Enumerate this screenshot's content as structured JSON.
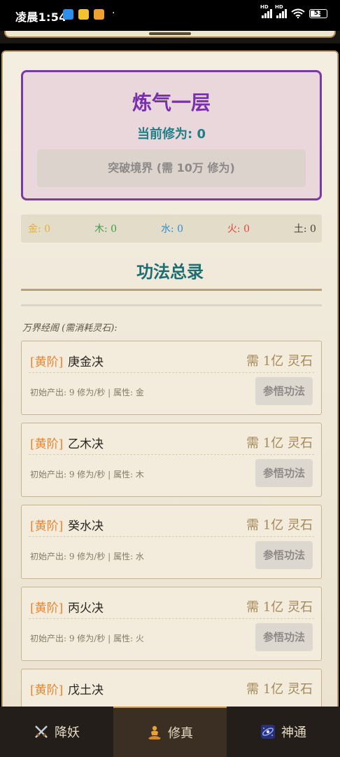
{
  "status_bar": {
    "time": "凌晨1:54",
    "battery": "53"
  },
  "realm": {
    "title": "炼气一层",
    "cultivation_label": "当前修为:",
    "cultivation_value": "0",
    "breakthrough_button": "突破境界 (需 10万 修为)"
  },
  "elements": [
    {
      "label": "金: 0",
      "color": "#e3b13a"
    },
    {
      "label": "木: 0",
      "color": "#3f9a4c"
    },
    {
      "label": "水: 0",
      "color": "#2f8fd1"
    },
    {
      "label": "火: 0",
      "color": "#e0473f"
    },
    {
      "label": "土: 0",
      "color": "#4a4036"
    }
  ],
  "section": {
    "title": "功法总录",
    "sub_label": "万界经阁 (需消耗灵石):"
  },
  "skills": [
    {
      "grade": "[黄阶]",
      "name": "庚金决",
      "cost": "需 1亿 灵石",
      "desc": "初始产出: 9 修为/秒 | 属性: 金",
      "button": "参悟功法"
    },
    {
      "grade": "[黄阶]",
      "name": "乙木决",
      "cost": "需 1亿 灵石",
      "desc": "初始产出: 9 修为/秒 | 属性: 木",
      "button": "参悟功法"
    },
    {
      "grade": "[黄阶]",
      "name": "癸水决",
      "cost": "需 1亿 灵石",
      "desc": "初始产出: 9 修为/秒 | 属性: 水",
      "button": "参悟功法"
    },
    {
      "grade": "[黄阶]",
      "name": "丙火决",
      "cost": "需 1亿 灵石",
      "desc": "初始产出: 9 修为/秒 | 属性: 火",
      "button": "参悟功法"
    },
    {
      "grade": "[黄阶]",
      "name": "戊土决",
      "cost": "需 1亿 灵石",
      "desc": "",
      "button": ""
    }
  ],
  "nav": {
    "items": [
      {
        "label": "降妖",
        "icon": "crossed-swords-icon"
      },
      {
        "label": "修真",
        "icon": "meditation-icon"
      },
      {
        "label": "神通",
        "icon": "galaxy-icon"
      }
    ],
    "active_index": 1
  }
}
